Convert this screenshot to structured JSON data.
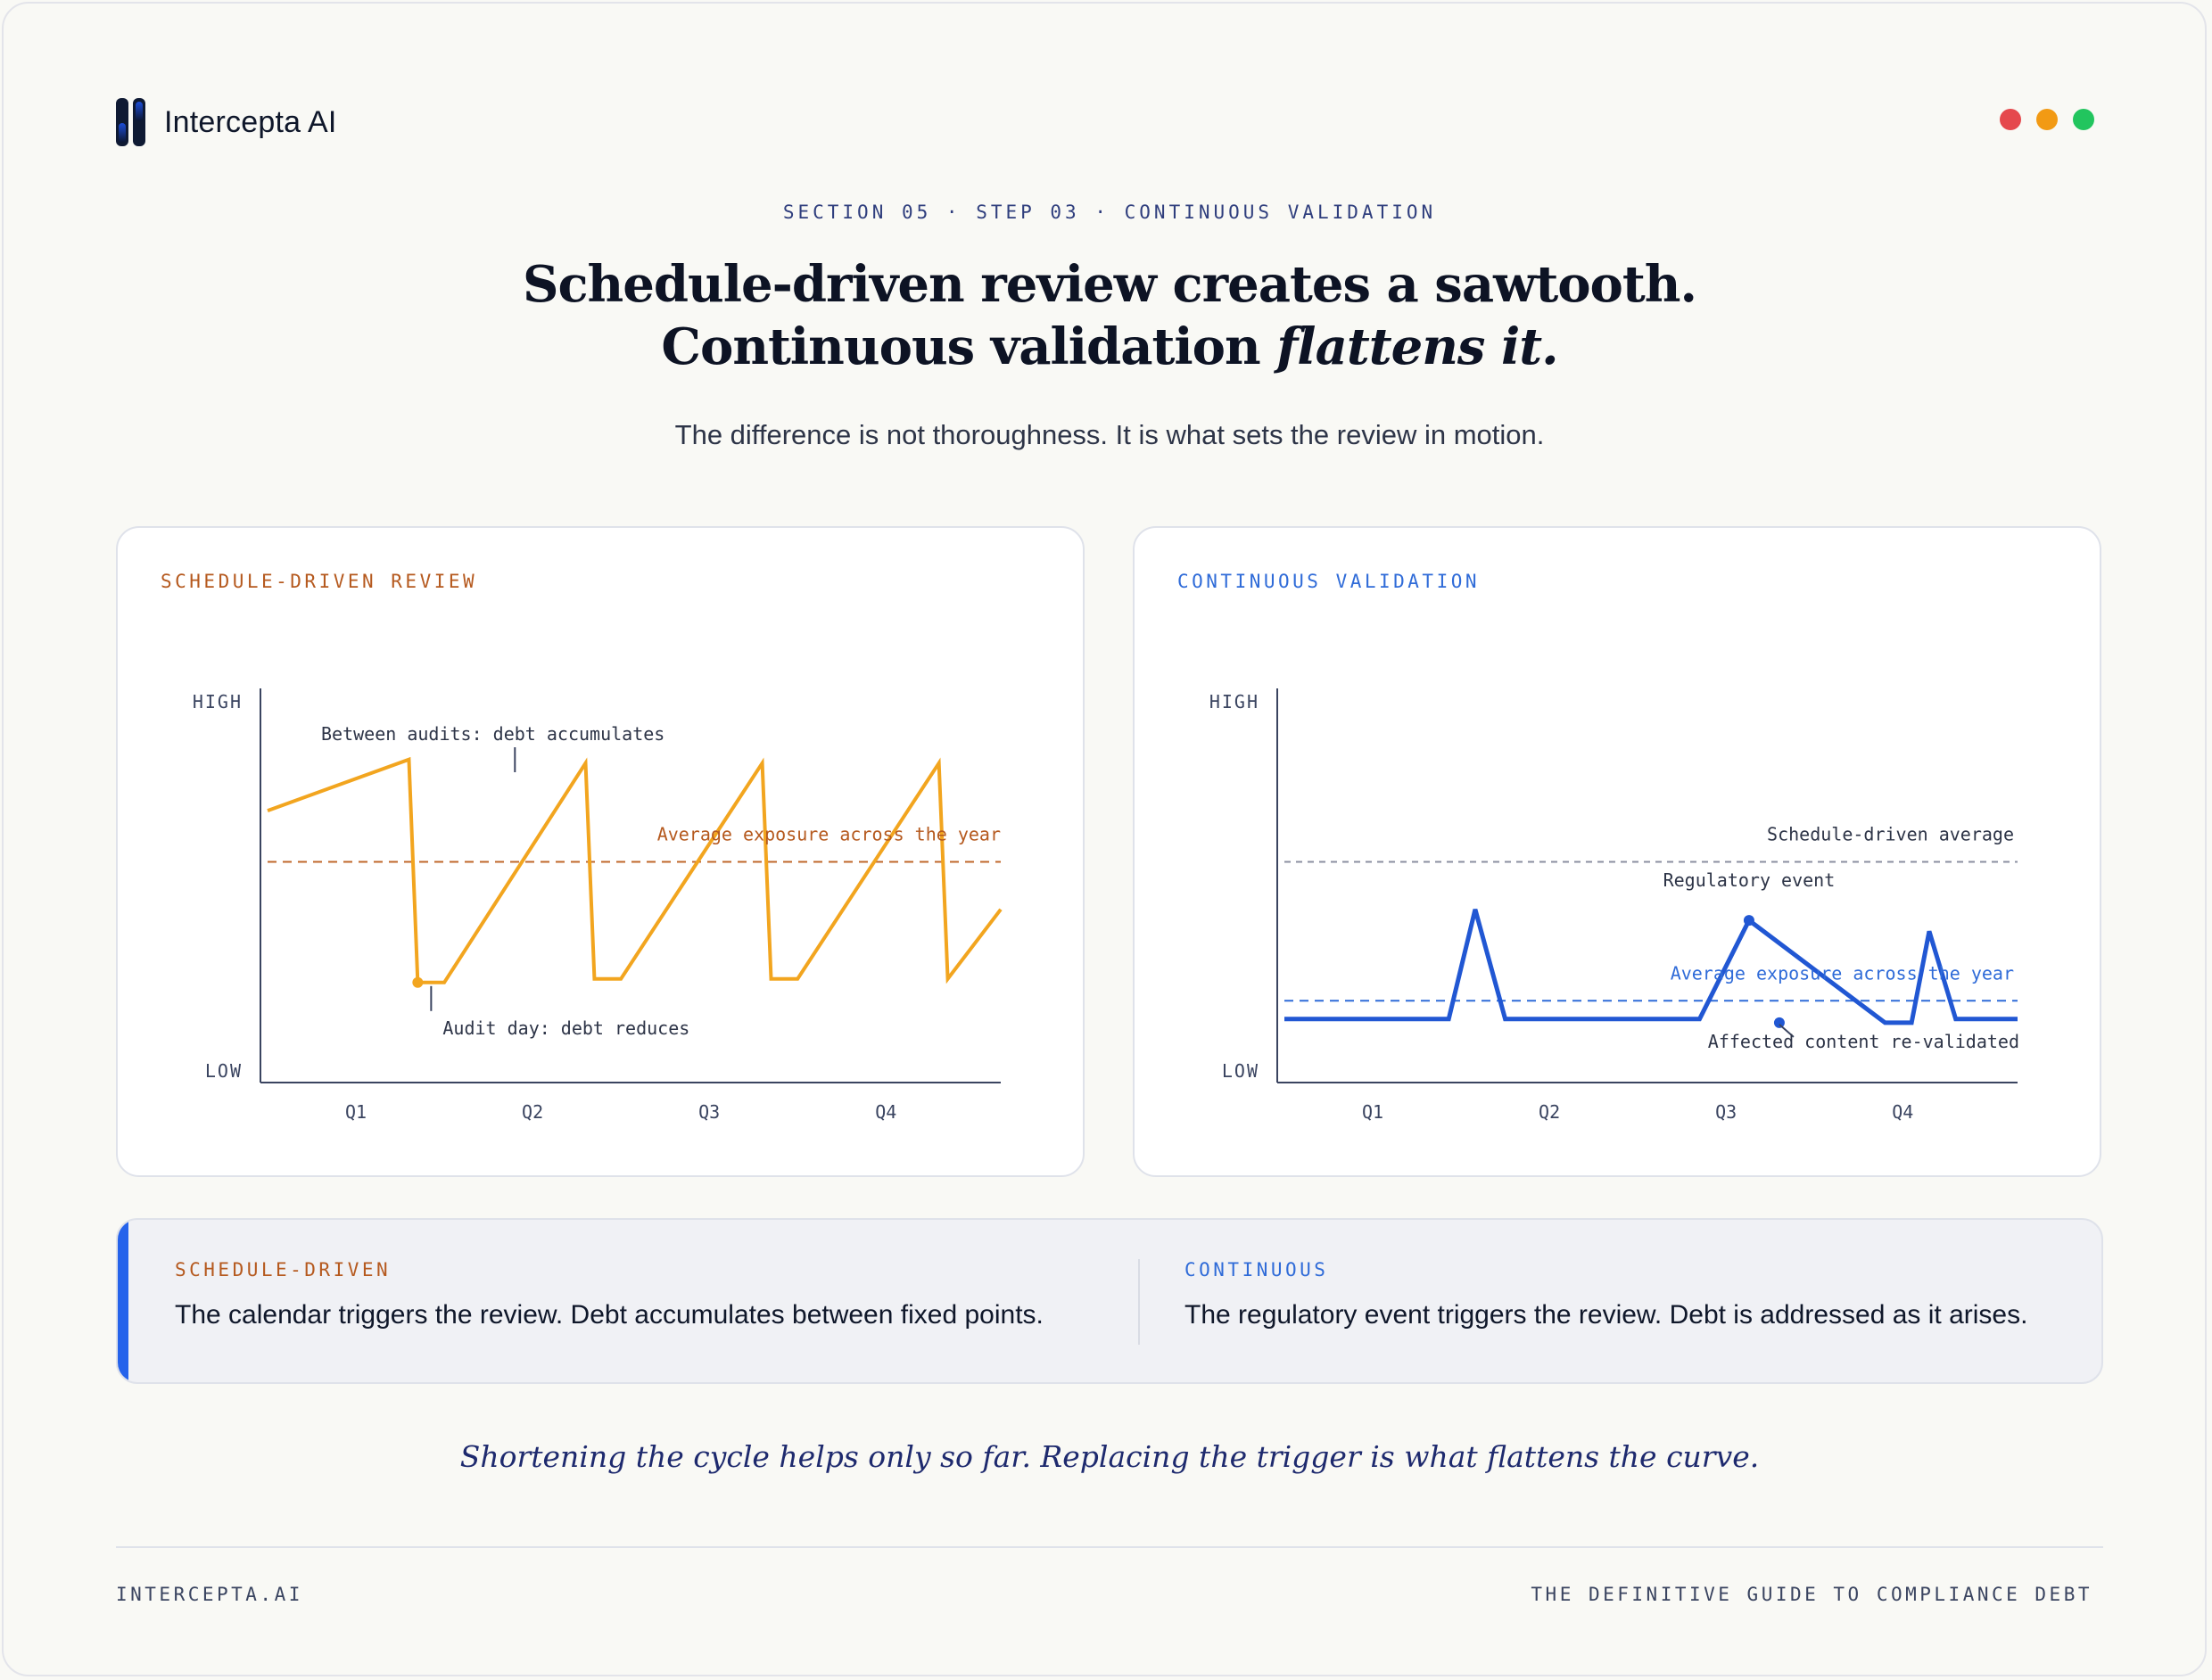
{
  "brand": {
    "name": "Intercepta AI",
    "logo_icon": "intercepta-logo-icon"
  },
  "window_controls": {
    "colors": [
      "#e5484d",
      "#f29a14",
      "#22c55e"
    ]
  },
  "eyebrow": "SECTION 05 · STEP 03 · CONTINUOUS VALIDATION",
  "headline": {
    "line1": "Schedule-driven review creates a sawtooth.",
    "line2_plain": "Continuous validation ",
    "line2_italic": "flattens it."
  },
  "subhead": "The difference is not thoroughness. It is what sets the review in motion.",
  "colors": {
    "orange": "#f2a51f",
    "orange_dark": "#b5591e",
    "blue": "#2157d3",
    "blue_label": "#2f6bd8"
  },
  "chart_data": [
    {
      "type": "line",
      "title": "SCHEDULE-DRIVEN REVIEW",
      "y_tick_labels": [
        "HIGH",
        "LOW"
      ],
      "x_tick_labels": [
        "Q1",
        "Q2",
        "Q3",
        "Q4"
      ],
      "xlim": [
        0,
        4.15
      ],
      "ylim": [
        0,
        100
      ],
      "series": [
        {
          "color": "#f2a51f",
          "x": [
            0,
            0.8,
            0.85,
            1.0,
            1.8,
            1.85,
            2.0,
            2.8,
            2.85,
            3.0,
            3.8,
            3.85,
            4.15
          ],
          "y": [
            69,
            83,
            22,
            22,
            82,
            23,
            23,
            82,
            23,
            23,
            82,
            23,
            42
          ]
        }
      ],
      "reference_line": {
        "label": "Average exposure across the year",
        "y": 55,
        "color": "#c0672b",
        "dashed": true
      },
      "annotations": [
        {
          "text": "Between audits: debt accumulates",
          "x": 1.4,
          "y": 83
        },
        {
          "text": "Audit day: debt reduces",
          "x": 0.85,
          "y": 22
        }
      ]
    },
    {
      "type": "line",
      "title": "CONTINUOUS VALIDATION",
      "y_tick_labels": [
        "HIGH",
        "LOW"
      ],
      "x_tick_labels": [
        "Q1",
        "Q2",
        "Q3",
        "Q4"
      ],
      "xlim": [
        0,
        4.15
      ],
      "ylim": [
        0,
        100
      ],
      "series": [
        {
          "color": "#2157d3",
          "x": [
            0,
            0.93,
            1.08,
            1.25,
            2.0,
            2.35,
            2.63,
            3.4,
            3.55,
            3.65,
            3.8,
            4.15
          ],
          "y": [
            12,
            12,
            42,
            12,
            12,
            12,
            39,
            11,
            11,
            36,
            12,
            12
          ]
        }
      ],
      "reference_lines": [
        {
          "label": "Schedule-driven average",
          "y": 55,
          "color": "#8b8fa0",
          "dashed": true
        },
        {
          "label": "Average exposure across the year",
          "y": 17,
          "color": "#2f6bd8",
          "dashed": true
        }
      ],
      "annotations": [
        {
          "text": "Regulatory event",
          "x": 2.63,
          "y": 39
        },
        {
          "text": "Affected content re-validated",
          "x": 2.63,
          "y": 11
        }
      ]
    }
  ],
  "compare": {
    "left": {
      "label": "SCHEDULE-DRIVEN",
      "text": "The calendar triggers the review. Debt accumulates between fixed points."
    },
    "right": {
      "label": "CONTINUOUS",
      "text": "The regulatory event triggers the review. Debt is addressed as it arises."
    }
  },
  "quote": "Shortening the cycle helps only so far. Replacing the trigger is what flattens the curve.",
  "footer": {
    "left": "INTERCEPTA.AI",
    "right": "THE DEFINITIVE GUIDE TO COMPLIANCE DEBT"
  }
}
